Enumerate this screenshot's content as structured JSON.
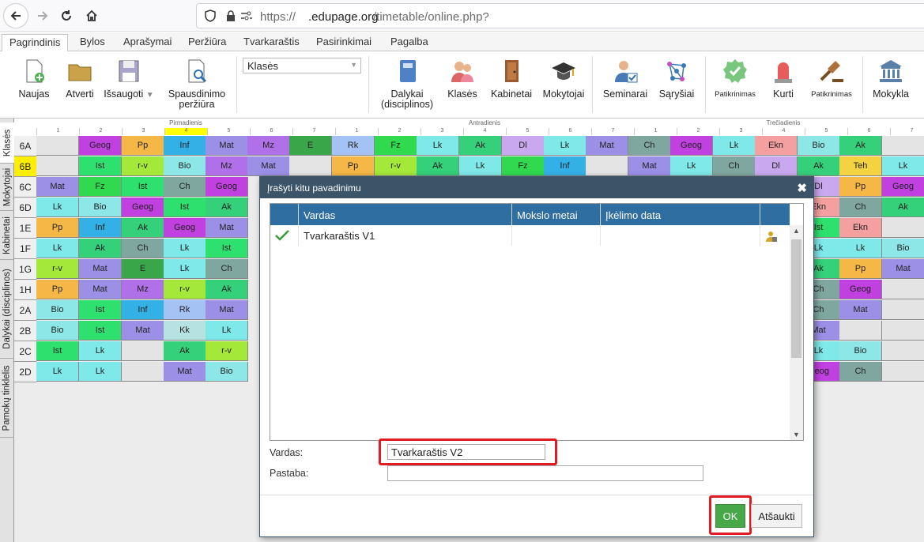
{
  "browser": {
    "url_prefix": "https://",
    "url_domain": ".edupage.org",
    "url_path": "/timetable/online.php?"
  },
  "menu": {
    "tabs": [
      "Pagrindinis",
      "Bylos",
      "Aprašymai",
      "Peržiūra",
      "Tvarkaraštis",
      "Pasirinkimai",
      "Pagalba"
    ],
    "active": "Pagrindinis"
  },
  "ribbon": {
    "new_label": "Naujas",
    "open_label": "Atverti",
    "save_label": "Išsaugoti",
    "print_label_1": "Spausdinimo",
    "print_label_2": "peržiūra",
    "select_value": "Klasės",
    "subjects_label_1": "Dalykai",
    "subjects_label_2": "(disciplinos)",
    "classes_label": "Klasės",
    "rooms_label": "Kabinetai",
    "teachers_label": "Mokytojai",
    "seminars_label": "Seminarai",
    "relations_label": "Sąryšiai",
    "check_label": "Patikrinimas",
    "generate_label": "Kurti",
    "check2_label": "Patikrinimas",
    "school_label": "Mokykla"
  },
  "sidetabs": [
    "Klasės",
    "Mokytojai",
    "Kabinetai",
    "Dalykai (disciplinos)",
    "Pamokų tinklelis"
  ],
  "timetable": {
    "days": [
      "Pirmadienis",
      "Antradienis",
      "Trečiadienis"
    ],
    "periods": [
      "1",
      "2",
      "3",
      "4",
      "5",
      "6",
      "7"
    ],
    "rows": [
      {
        "label": "6A",
        "cells": [
          "",
          "Geog",
          "Pp",
          "Inf",
          "Mat",
          "Mz",
          "E",
          "Rk",
          "Fz",
          "Lk",
          "Ak",
          "Dl",
          "Lk",
          "Mat",
          "Ch",
          "Geog",
          "Lk",
          "Ekn",
          "Bio",
          "Ak",
          ""
        ]
      },
      {
        "label": "6B",
        "cells": [
          "",
          "Ist",
          "r-v",
          "Bio",
          "Mz",
          "Mat",
          "",
          "Pp",
          "r-v",
          "Ak",
          "Lk",
          "Fz",
          "Inf",
          "",
          "Mat",
          "Lk",
          "Ch",
          "Dl",
          "Ak",
          "Teh",
          "Lk"
        ]
      },
      {
        "label": "6C",
        "cells": [
          "Mat",
          "Fz",
          "Ist",
          "Ch",
          "Geog",
          "",
          "",
          "",
          "",
          "",
          "",
          "",
          "",
          "",
          "",
          "",
          "",
          "",
          "Dl",
          "Pp",
          "Geog"
        ]
      },
      {
        "label": "6D",
        "cells": [
          "Lk",
          "Bio",
          "Geog",
          "Ist",
          "Ak",
          "",
          "",
          "",
          "",
          "",
          "",
          "",
          "",
          "",
          "",
          "",
          "",
          "",
          "Ekn",
          "Ch",
          "Ak"
        ]
      },
      {
        "label": "1E",
        "cells": [
          "Pp",
          "Inf",
          "Ak",
          "Geog",
          "Mat",
          "",
          "",
          "",
          "",
          "",
          "",
          "",
          "",
          "",
          "",
          "",
          "",
          "",
          "Ist",
          "Ekn",
          ""
        ]
      },
      {
        "label": "1F",
        "cells": [
          "Lk",
          "Ak",
          "Ch",
          "Lk",
          "Ist",
          "",
          "",
          "",
          "",
          "",
          "",
          "",
          "",
          "",
          "",
          "",
          "",
          "",
          "Lk",
          "Lk",
          "Bio"
        ]
      },
      {
        "label": "1G",
        "cells": [
          "r-v",
          "Mat",
          "E",
          "Lk",
          "Ch",
          "",
          "",
          "",
          "",
          "",
          "",
          "",
          "",
          "",
          "",
          "",
          "",
          "",
          "Ak",
          "Pp",
          "Mat"
        ]
      },
      {
        "label": "1H",
        "cells": [
          "Pp",
          "Mat",
          "Mz",
          "r-v",
          "Ak",
          "",
          "",
          "",
          "",
          "",
          "",
          "",
          "",
          "",
          "",
          "",
          "",
          "",
          "Ch",
          "Geog",
          ""
        ]
      },
      {
        "label": "2A",
        "cells": [
          "Bio",
          "Ist",
          "Inf",
          "Rk",
          "Mat",
          "",
          "",
          "",
          "",
          "",
          "",
          "",
          "",
          "",
          "",
          "",
          "",
          "",
          "Ch",
          "Mat",
          ""
        ]
      },
      {
        "label": "2B",
        "cells": [
          "Bio",
          "Ist",
          "Mat",
          "Kk",
          "Lk",
          "",
          "",
          "",
          "",
          "",
          "",
          "",
          "",
          "",
          "",
          "",
          "",
          "",
          "Mat",
          "",
          ""
        ]
      },
      {
        "label": "2C",
        "cells": [
          "Ist",
          "Lk",
          "",
          "Ak",
          "r-v",
          "",
          "",
          "",
          "",
          "",
          "",
          "",
          "",
          "",
          "",
          "",
          "",
          "",
          "Lk",
          "Bio",
          ""
        ]
      },
      {
        "label": "2D",
        "cells": [
          "Lk",
          "Lk",
          "",
          "Mat",
          "Bio",
          "",
          "",
          "",
          "",
          "",
          "",
          "",
          "",
          "",
          "",
          "",
          "",
          "",
          "Geog",
          "Ch",
          ""
        ]
      }
    ]
  },
  "dialog": {
    "title": "Įrašyti kitu pavadinimu",
    "col_name": "Vardas",
    "col_year": "Mokslo metai",
    "col_date": "Įkėlimo data",
    "row_name": "Tvarkaraštis V1",
    "row_year": "",
    "row_date": "",
    "name_label": "Vardas:",
    "name_value": "Tvarkaraštis V2",
    "note_label": "Pastaba:",
    "note_value": "",
    "ok_label": "OK",
    "cancel_label": "Atšaukti"
  }
}
